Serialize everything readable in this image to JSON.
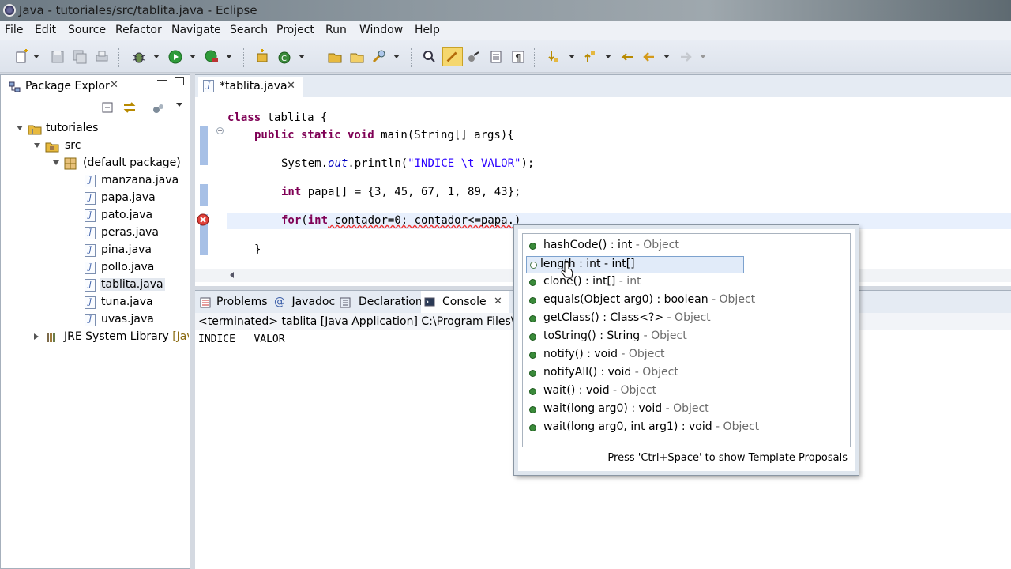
{
  "window": {
    "title": "Java - tutoriales/src/tablita.java - Eclipse"
  },
  "menu": [
    "File",
    "Edit",
    "Source",
    "Refactor",
    "Navigate",
    "Search",
    "Project",
    "Run",
    "Window",
    "Help"
  ],
  "package_explorer": {
    "tab_label": "Package Explor",
    "tree": [
      {
        "label": "tutoriales",
        "icon": "project-icon",
        "indent": 1
      },
      {
        "label": "src",
        "icon": "src-folder-icon",
        "indent": 2
      },
      {
        "label": "(default package)",
        "icon": "package-icon",
        "indent": 3
      },
      {
        "label": "manzana.java",
        "icon": "java-file-icon",
        "indent": 4
      },
      {
        "label": "papa.java",
        "icon": "java-file-icon",
        "indent": 4
      },
      {
        "label": "pato.java",
        "icon": "java-file-icon",
        "indent": 4
      },
      {
        "label": "peras.java",
        "icon": "java-file-icon",
        "indent": 4
      },
      {
        "label": "pina.java",
        "icon": "java-file-icon",
        "indent": 4
      },
      {
        "label": "pollo.java",
        "icon": "java-file-icon",
        "indent": 4
      },
      {
        "label": "tablita.java",
        "icon": "java-file-icon",
        "indent": 4,
        "selected": true
      },
      {
        "label": "tuna.java",
        "icon": "java-file-icon",
        "indent": 4
      },
      {
        "label": "uvas.java",
        "icon": "java-file-icon",
        "indent": 4
      },
      {
        "label": "JRE System Library",
        "suffix": "[JavaS",
        "icon": "library-icon",
        "indent": 2
      }
    ]
  },
  "editor": {
    "tab_label": "*tablita.java",
    "code": {
      "class_kw": "class",
      "class_name": " tablita {",
      "public_static_void": "public static void",
      "main_sig": " main(String[] args){",
      "sysout_pre": "System.",
      "sysout_out": "out",
      "sysout_mid": ".println(",
      "sysout_str": "\"INDICE \\t VALOR\"",
      "sysout_end": ");",
      "int_kw": "int",
      "papa_decl": " papa[] = {3, 45, 67, 1, 89, 43};",
      "for_kw": "for",
      "for_open": "(",
      "for_int_kw": "int",
      "for_rest": " contador=0; contador<=papa.)",
      "close_brace": "}"
    }
  },
  "console_view": {
    "tabs": [
      "Problems",
      "Javadoc",
      "Declaration",
      "Console"
    ],
    "status": "<terminated> tablita [Java Application] C:\\Program Files\\Java\\jre",
    "output": "INDICE   VALOR"
  },
  "completion": {
    "items": [
      {
        "sig": "hashCode() : int",
        "owner": " - Object",
        "hollow": false
      },
      {
        "sig": "length : int - int[]",
        "owner": "",
        "hollow": true,
        "selected": true
      },
      {
        "sig": "clone() : int[]",
        "owner": " - int",
        "hollow": false
      },
      {
        "sig": "equals(Object arg0) : boolean",
        "owner": " - Object",
        "hollow": false
      },
      {
        "sig": "getClass() : Class<?>",
        "owner": " - Object",
        "hollow": false
      },
      {
        "sig": "toString() : String",
        "owner": " - Object",
        "hollow": false
      },
      {
        "sig": "notify() : void",
        "owner": " - Object",
        "hollow": false
      },
      {
        "sig": "notifyAll() : void",
        "owner": " - Object",
        "hollow": false
      },
      {
        "sig": "wait() : void",
        "owner": " - Object",
        "hollow": false
      },
      {
        "sig": "wait(long arg0) : void",
        "owner": " - Object",
        "hollow": false
      },
      {
        "sig": "wait(long arg0, int arg1) : void",
        "owner": " - Object",
        "hollow": false
      }
    ],
    "footer": "Press 'Ctrl+Space' to show Template Proposals"
  }
}
